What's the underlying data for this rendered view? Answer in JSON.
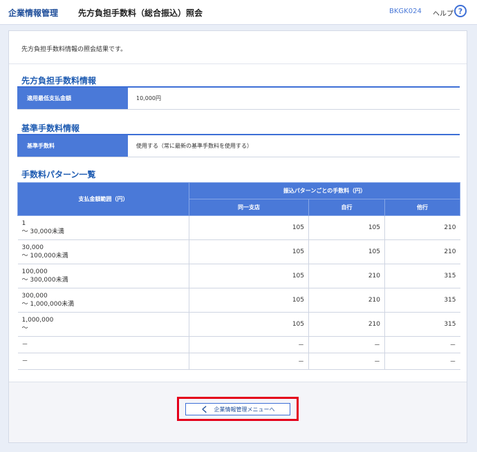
{
  "header": {
    "breadcrumb_root": "企業情報管理",
    "page_title": "先方負担手数料（総合振込）照会",
    "screen_id": "BKGK024",
    "help_label": "ヘルプ",
    "help_icon_glyph": "?"
  },
  "intro_text": "先方負担手数料情報の照会結果です。",
  "section_fee_info": {
    "title": "先方負担手数料情報",
    "key": "適用最低支払金額",
    "value": "10,000円"
  },
  "section_base_fee": {
    "title": "基準手数料情報",
    "key": "基準手数料",
    "value": "使用する（常に最新の基準手数料を使用する）"
  },
  "section_patterns": {
    "title": "手数料パターン一覧",
    "col_range": "支払金額範囲（円）",
    "col_group": "振込パターンごとの手数料（円）",
    "col_same_branch": "同一支店",
    "col_own_bank": "自行",
    "col_other_bank": "他行",
    "rows": [
      {
        "from": "1",
        "to": "～ 30,000未満",
        "same": "105",
        "own": "105",
        "other": "210"
      },
      {
        "from": "30,000",
        "to": "～ 100,000未満",
        "same": "105",
        "own": "105",
        "other": "210"
      },
      {
        "from": "100,000",
        "to": "～ 300,000未満",
        "same": "105",
        "own": "210",
        "other": "315"
      },
      {
        "from": "300,000",
        "to": "～ 1,000,000未満",
        "same": "105",
        "own": "210",
        "other": "315"
      },
      {
        "from": "1,000,000",
        "to": "～",
        "same": "105",
        "own": "210",
        "other": "315"
      }
    ],
    "dash_rows": [
      {
        "range": "－",
        "same": "－",
        "own": "－",
        "other": "－"
      },
      {
        "range": "－",
        "same": "－",
        "own": "－",
        "other": "－"
      }
    ]
  },
  "footer": {
    "back_button_label": "企業情報管理メニューへ",
    "back_icon": "chevron-left-icon",
    "back_icon_glyph": "く"
  },
  "colors": {
    "accent": "#4a79d8",
    "title_blue": "#1f5cb2",
    "highlight_red": "#e4001b"
  }
}
